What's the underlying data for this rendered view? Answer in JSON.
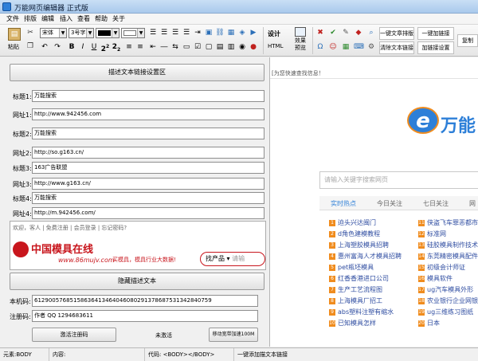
{
  "window": {
    "title": "万能网页编辑器 正式版"
  },
  "menu": [
    "文件",
    "排版",
    "编辑",
    "插入",
    "查看",
    "帮助",
    "关于"
  ],
  "toolbar": {
    "paste_label": "粘贴",
    "font_family": "宋体",
    "font_size": "3号字",
    "bold": "B",
    "italic": "I",
    "underline": "U",
    "superscript": "2",
    "subscript": "2",
    "design_label": "设计",
    "html_label": "HTML",
    "preview_label": "效果预览",
    "buttons": [
      "一键文章排版",
      "一键加链接",
      "清除文本链接",
      "加链接设置",
      "复制"
    ]
  },
  "left": {
    "header_button": "描述文本链接设置区",
    "fields": [
      {
        "label": "标题1:",
        "value": "万能搜索"
      },
      {
        "label": "网址1:",
        "value": "http://www.942456.com"
      },
      {
        "label": "标题2:",
        "value": "万能搜索"
      },
      {
        "label": "网址2:",
        "value": "http://so.g163.cn/"
      },
      {
        "label": "标题3:",
        "value": "163广告联盟"
      },
      {
        "label": "网址3:",
        "value": "http://www.g163.cn/"
      },
      {
        "label": "标题4:",
        "value": "万能搜索"
      },
      {
        "label": "网址4:",
        "value": "http://m.942456.com/"
      }
    ],
    "preview": {
      "login_bar": "欢迎，客人 | 免费注册 | 会员登录 | 忘记密码?",
      "banner_name": "中国模具在线",
      "banner_url": "www.86mujv.com",
      "banner_slogan": "买模具，模具行业大数据!",
      "search_product": "找产品",
      "search_hint": "请输"
    },
    "hide_button": "隐藏描述文本",
    "machine_code_label": "本机码:",
    "machine_code": "61290057685158636413464046080291378687531342840759",
    "reg_code_label": "注册码:",
    "reg_code": "作者 QQ 1294683611",
    "activate_button": "激活注册码",
    "activation_status": "未激活",
    "speed_button": "移动宽带加速100M"
  },
  "right": {
    "hint": "[为您快速查找信息！",
    "logo_letter": "e",
    "logo_text": "万能",
    "search_placeholder": "请输入关键字搜索网页",
    "tabs": [
      "实时热点",
      "今日关注",
      "七日关注",
      "网"
    ],
    "hot_list": [
      {
        "num": "1",
        "text": "迫头兴达闽门"
      },
      {
        "num": "2",
        "text": "d角色建模教程"
      },
      {
        "num": "3",
        "text": "上海塑胶模具招聘"
      },
      {
        "num": "4",
        "text": "惠州富海人才模具招聘"
      },
      {
        "num": "5",
        "text": "pet瓶坯模具"
      },
      {
        "num": "6",
        "text": "红香香港进口公司"
      },
      {
        "num": "7",
        "text": "生产工艺流程图"
      },
      {
        "num": "8",
        "text": "上海模具厂招工"
      },
      {
        "num": "9",
        "text": "abs塑料注塑有缩水"
      },
      {
        "num": "10",
        "text": "已知模具怎样"
      }
    ],
    "hot_list_2": [
      {
        "num": "11",
        "text": "侠盗飞车罪恶都市"
      },
      {
        "num": "12",
        "text": "标准网"
      },
      {
        "num": "13",
        "text": "硅胶模具制作技术"
      },
      {
        "num": "14",
        "text": "东莞精密模具配件"
      },
      {
        "num": "15",
        "text": "初级会计师证"
      },
      {
        "num": "16",
        "text": "模具软件"
      },
      {
        "num": "17",
        "text": "ug汽车模具外形"
      },
      {
        "num": "18",
        "text": "农业银行企业网银"
      },
      {
        "num": "19",
        "text": "ug三维练习图纸"
      },
      {
        "num": "20",
        "text": "日本"
      }
    ]
  },
  "statusbar": {
    "element_label": "元素:BODY",
    "content_label": "内容:",
    "code_label": "代码:  <BODY></BODY>",
    "message": "一键添加描文本链接"
  },
  "colors": {
    "accent_blue": "#2d7fd8",
    "logo_orange": "#f08c1e",
    "link_blue": "#2f4da1",
    "banner_red": "#c8161d"
  }
}
